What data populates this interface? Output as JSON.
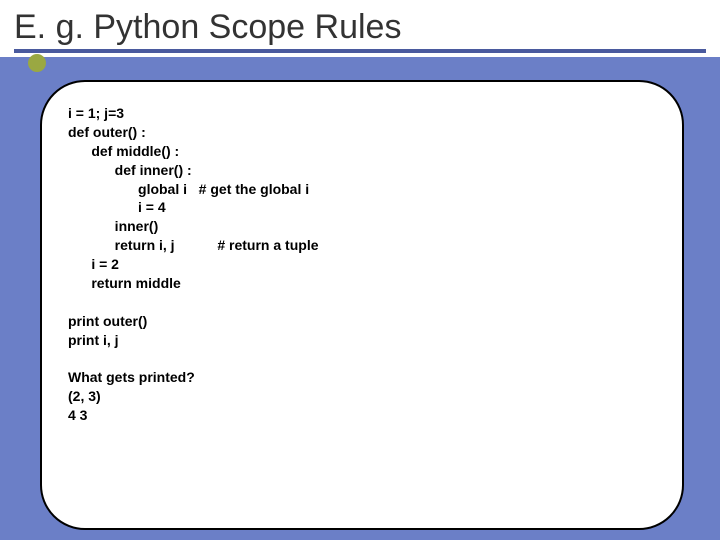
{
  "slide": {
    "title": "E. g. Python Scope Rules",
    "code": {
      "l1": "i = 1; j=3",
      "l2": "def outer() :",
      "l3": "      def middle() :",
      "l4": "            def inner() :",
      "l5": "                  global i   # get the global i",
      "l6": "                  i = 4",
      "l7": "            inner()",
      "l8": "            return i, j           # return a tuple",
      "l9": "      i = 2",
      "l10": "      return middle",
      "l11": "",
      "l12": "print outer()",
      "l13": "print i, j",
      "l14": "",
      "l15": "What gets printed?",
      "l16": "(2, 3)",
      "l17": "4 3"
    }
  }
}
